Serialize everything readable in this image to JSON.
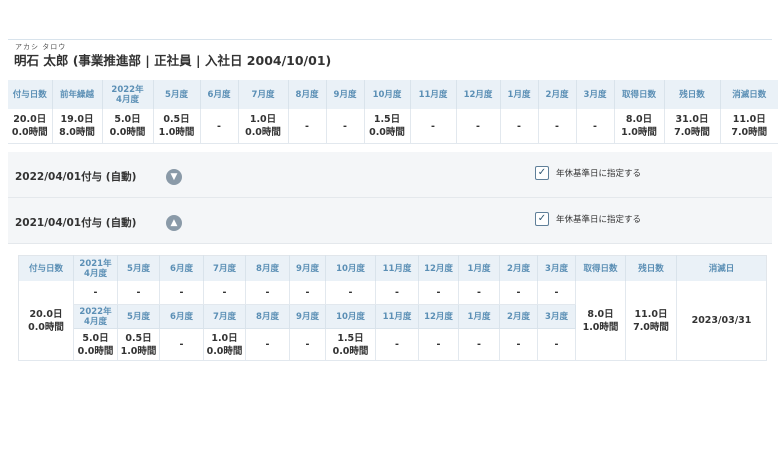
{
  "employee": {
    "kana": "アカシ タロウ",
    "name_line": "明石 太郎 (事業推進部 | 正社員 | 入社日 2004/10/01)"
  },
  "summary_table": {
    "headers": [
      "付与日数",
      "前年繰越",
      "2022年\n4月度",
      "5月度",
      "6月度",
      "7月度",
      "8月度",
      "9月度",
      "10月度",
      "11月度",
      "12月度",
      "1月度",
      "2月度",
      "3月度",
      "取得日数",
      "残日数",
      "消滅日数"
    ],
    "row": [
      [
        "20.0日",
        "0.0時間"
      ],
      [
        "19.0日",
        "8.0時間"
      ],
      [
        "5.0日",
        "0.0時間"
      ],
      [
        "0.5日",
        "1.0時間"
      ],
      [
        "-"
      ],
      [
        "1.0日",
        "0.0時間"
      ],
      [
        "-"
      ],
      [
        "-"
      ],
      [
        "1.5日",
        "0.0時間"
      ],
      [
        "-"
      ],
      [
        "-"
      ],
      [
        "-"
      ],
      [
        "-"
      ],
      [
        "-"
      ],
      [
        "8.0日",
        "1.0時間"
      ],
      [
        "31.0日",
        "7.0時間"
      ],
      [
        "11.0日",
        "7.0時間"
      ]
    ]
  },
  "sections": [
    {
      "title": "2022/04/01付与 (自動)",
      "toggle_icon": "chevron-down",
      "checkbox_label": "年休基準日に指定する",
      "checked": true,
      "expanded": false
    },
    {
      "title": "2021/04/01付与 (自動)",
      "toggle_icon": "chevron-up",
      "checkbox_label": "年休基準日に指定する",
      "checked": true,
      "expanded": true
    }
  ],
  "detail_table": {
    "headers": [
      "付与日数",
      "2021年\n4月度",
      "5月度",
      "6月度",
      "7月度",
      "8月度",
      "9月度",
      "10月度",
      "11月度",
      "12月度",
      "1月度",
      "2月度",
      "3月度",
      "取得日数",
      "残日数",
      "消滅日"
    ],
    "prev_row": [
      "-",
      "-",
      "-",
      "-",
      "-",
      "-",
      "-",
      "-",
      "-",
      "-",
      "-",
      "-"
    ],
    "grant": [
      "20.0日",
      "0.0時間"
    ],
    "sub_headers": [
      "2022年\n4月度",
      "5月度",
      "6月度",
      "7月度",
      "8月度",
      "9月度",
      "10月度",
      "11月度",
      "12月度",
      "1月度",
      "2月度",
      "3月度"
    ],
    "cur_row": [
      [
        "5.0日",
        "0.0時間"
      ],
      [
        "0.5日",
        "1.0時間"
      ],
      [
        "-"
      ],
      [
        "1.0日",
        "0.0時間"
      ],
      [
        "-"
      ],
      [
        "-"
      ],
      [
        "1.5日",
        "0.0時間"
      ],
      [
        "-"
      ],
      [
        "-"
      ],
      [
        "-"
      ],
      [
        "-"
      ],
      [
        "-"
      ]
    ],
    "acquired": [
      "8.0日",
      "1.0時間"
    ],
    "remaining": [
      "11.0日",
      "7.0時間"
    ],
    "expiry": "2023/03/31"
  },
  "colors": {
    "header_bg": "#eaf1f7",
    "header_text": "#5b8fb5",
    "section_bg": "#f4f6f8",
    "toggle_bg": "#8a9aa8"
  }
}
